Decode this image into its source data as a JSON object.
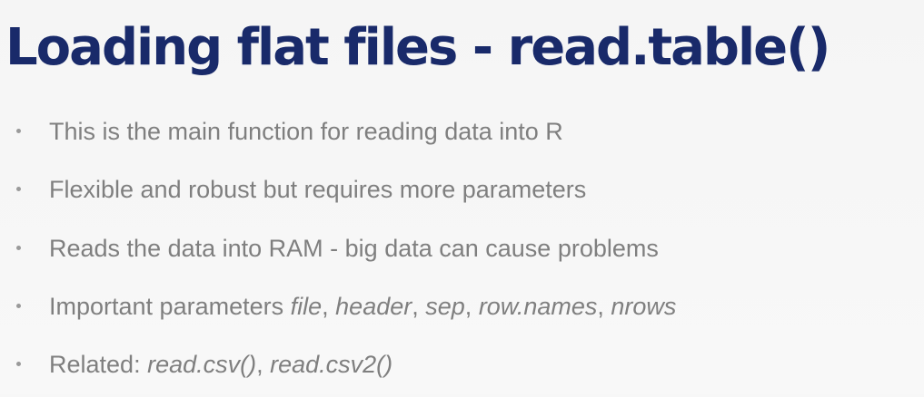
{
  "slide": {
    "title": "Loading flat files - read.table()",
    "bullets": [
      {
        "text": "This is the main function for reading data into R"
      },
      {
        "text": "Flexible and robust but requires more parameters"
      },
      {
        "text": "Reads the data into RAM - big data can cause problems"
      },
      {
        "prefix": "Important parameters ",
        "params": [
          "file",
          "header",
          "sep",
          "row.names",
          "nrows"
        ],
        "sep": ", "
      },
      {
        "prefix": "Related: ",
        "funcs": [
          "read.csv()",
          "read.csv2()"
        ],
        "sep": ", "
      }
    ],
    "colors": {
      "title": "#192a6a",
      "bullet_text": "#7f7f7f",
      "background": "#f7f7f7"
    }
  }
}
